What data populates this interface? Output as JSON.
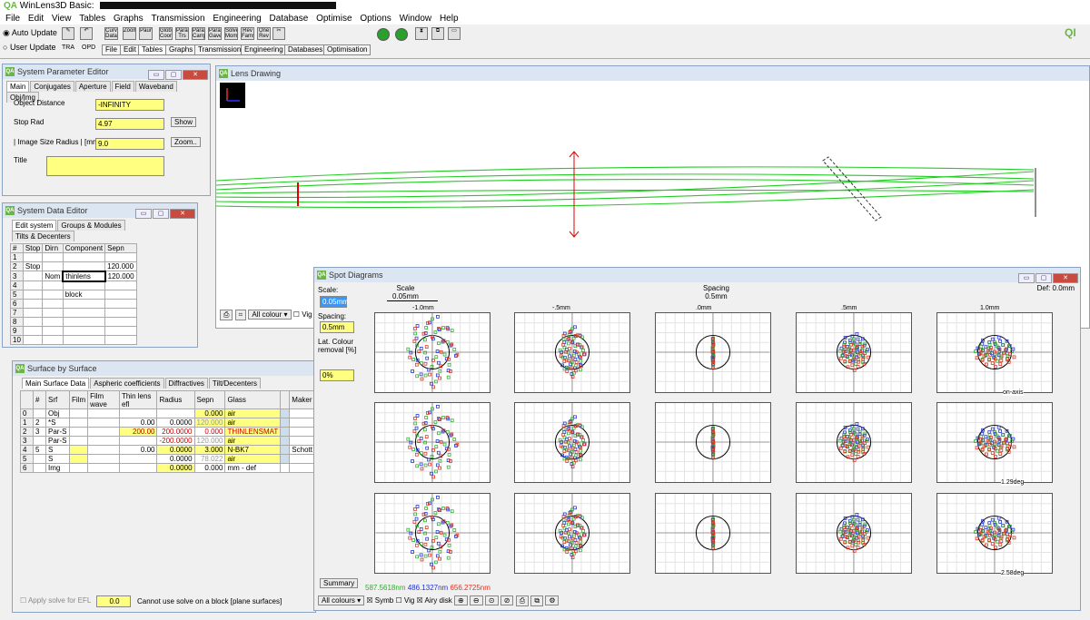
{
  "app": {
    "title": "WinLens3D Basic:"
  },
  "menu": [
    "File",
    "Edit",
    "View",
    "Tables",
    "Graphs",
    "Transmission",
    "Engineering",
    "Database",
    "Optimise",
    "Options",
    "Window",
    "Help"
  ],
  "toolbar": {
    "auto_update": "Auto Update",
    "user_update": "User Update",
    "btn_tra": "TRA",
    "btn_opd": "OPD",
    "icons": [
      "Curv Data",
      "Zoom",
      "Paur",
      "Global Coords",
      "Paraxi Trs",
      "Paraxi Carrp",
      "Paraxi Gave",
      "Solve Moms",
      "Rev Fams",
      "One Rev"
    ],
    "tabs": [
      "File",
      "Edit",
      "Tables",
      "Graphs",
      "Transmission",
      "Engineering",
      "Databases",
      "Optimisation"
    ]
  },
  "sys_param": {
    "title": "System Parameter Editor",
    "tabs": [
      "Main",
      "Conjugates",
      "Aperture",
      "Field",
      "Waveband",
      "Obj/Img"
    ],
    "object_distance_label": "Object Distance",
    "object_distance": "-INFINITY",
    "stop_rad_label": "Stop Rad",
    "stop_rad": "4.97",
    "show_btn": "Show",
    "image_size_label": "| Image Size Radius |  [mm]",
    "image_size": "9.0",
    "zoom_btn": "Zoom..",
    "title_label": "Title"
  },
  "sys_data": {
    "title": "System Data Editor",
    "tabs": [
      "Edit system",
      "Groups & Modules",
      "Tilts & Decenters"
    ],
    "headers": [
      "#",
      "Stop",
      "Dirn",
      "Component",
      "Sepn"
    ],
    "rows": [
      [
        "1",
        "",
        "",
        "",
        ""
      ],
      [
        "2",
        "Stop",
        "",
        "",
        "120.000"
      ],
      [
        "3",
        "",
        "Nom",
        "thinlens",
        "120.000"
      ],
      [
        "4",
        "",
        "",
        "",
        ""
      ],
      [
        "5",
        "",
        "",
        "block",
        ""
      ],
      [
        "6",
        "",
        "",
        "",
        ""
      ],
      [
        "7",
        "",
        "",
        "",
        ""
      ],
      [
        "8",
        "",
        "",
        "",
        ""
      ],
      [
        "9",
        "",
        "",
        "",
        ""
      ],
      [
        "10",
        "",
        "",
        "",
        ""
      ]
    ]
  },
  "lens_drawing": {
    "title": "Lens Drawing",
    "colour_select": "All colour",
    "vig": "Vig"
  },
  "surface": {
    "title": "Surface by Surface",
    "tabs": [
      "Main Surface Data",
      "Aspheric coefficients",
      "Diffractives",
      "Tilt/Decenters"
    ],
    "headers": [
      "",
      "#",
      "Srf",
      "Film",
      "Film wave",
      "Thin lens efl",
      "Radius",
      "Sepn",
      "Glass",
      "",
      "Maker"
    ],
    "rows": [
      [
        "0",
        "",
        "Obj",
        "",
        "",
        "",
        "",
        "0.000",
        "air",
        "",
        ""
      ],
      [
        "1",
        "2",
        "*S",
        "",
        "",
        "0.00",
        "0.0000",
        "120.000",
        "air",
        "",
        ""
      ],
      [
        "2",
        "3",
        "Par-S",
        "",
        "",
        "200.00",
        "200.0000",
        "0.000",
        "THINLENSMAT",
        "",
        ""
      ],
      [
        "3",
        "",
        "Par-S",
        "",
        "",
        "",
        "-200.0000",
        "120.000",
        "air",
        "",
        ""
      ],
      [
        "4",
        "5",
        "S",
        "",
        "",
        "0.00",
        "0.0000",
        "3.000",
        "N-BK7",
        "",
        "Schott"
      ],
      [
        "5",
        "",
        "S",
        "",
        "",
        "",
        "0.0000",
        "78.022",
        "air",
        "",
        ""
      ],
      [
        "6",
        "",
        "Img",
        "",
        "",
        "",
        "0.0000",
        "0.000",
        "mm - def",
        "",
        ""
      ]
    ],
    "apply_solve": "Apply solve for EFL",
    "apply_value": "0.0",
    "status": "Cannot use solve on a block [plane surfaces]"
  },
  "spot": {
    "title": "Spot Diagrams",
    "scale_label": "Scale:",
    "scale_value": "0.05mm",
    "spacing_label": "Spacing:",
    "spacing_value": "0.5mm",
    "lat_colour_label": "Lat. Colour removal [%]",
    "lat_colour_value": "0%",
    "summary_btn": "Summary",
    "scale_header": "Scale",
    "scale_header_val": "0.05mm",
    "spacing_header": "Spacing",
    "spacing_header_val": "0.5mm",
    "def": "Def: 0.0mm",
    "columns": [
      "-1.0mm",
      "-.5mm",
      ".0mm",
      ".5mm",
      "1.0mm"
    ],
    "rows": [
      "on-axis",
      "1.29deg",
      "2.58deg"
    ],
    "wavelengths": [
      {
        "label": "587.5618nm",
        "color": "#33aa33"
      },
      {
        "label": "486.1327nm",
        "color": "#2233cc"
      },
      {
        "label": "656.2725nm",
        "color": "#dd3322"
      }
    ],
    "colours_select": "All colours",
    "symb": "Symb",
    "vig": "Vig",
    "airy": "Airy disk"
  }
}
